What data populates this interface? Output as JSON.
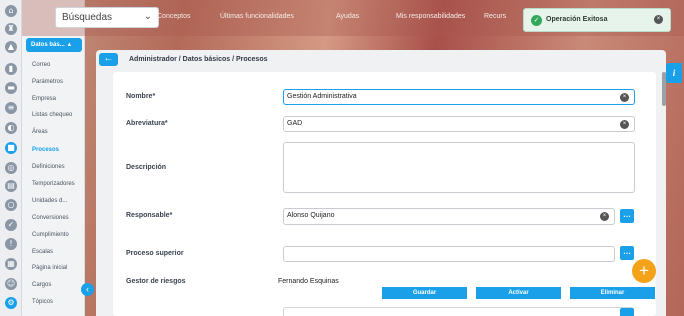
{
  "topbar": {
    "search_value": "Búsquedas",
    "nav": [
      "Conceptos",
      "Últimas funcionalidades",
      "Ayudas",
      "Mis responsabilidades",
      "Recurs"
    ]
  },
  "toast": {
    "message": "Operación Exitosa"
  },
  "sidebar": {
    "header": "Datos bás... ▲",
    "items": [
      {
        "label": "Correo"
      },
      {
        "label": "Parámetros"
      },
      {
        "label": "Empresa"
      },
      {
        "label": "Listas chequeo"
      },
      {
        "label": "Áreas"
      },
      {
        "label": "Procesos",
        "active": true
      },
      {
        "label": "Definiciones"
      },
      {
        "label": "Temporizadores"
      },
      {
        "label": "Unidades d..."
      },
      {
        "label": "Conversiones"
      },
      {
        "label": "Cumplimiento"
      },
      {
        "label": "Escalas"
      },
      {
        "label": "Página inicial"
      },
      {
        "label": "Cargos"
      },
      {
        "label": "Tópicos"
      }
    ]
  },
  "rail_icons": [
    "home-icon",
    "tower-icon",
    "user-icon",
    "chart-icon",
    "monitor-icon",
    "list-icon",
    "gauge-icon",
    "briefcase-icon",
    "target-icon",
    "document-icon",
    "circle-icon",
    "check-icon",
    "warning-icon",
    "calendar-icon",
    "person-icon",
    "triangle-icon",
    "gear-icon"
  ],
  "info_tab": "i",
  "breadcrumb": "Administrador / Datos básicos / Procesos",
  "form": {
    "nombre_label": "Nombre*",
    "nombre_value": "Gestión Administrativa",
    "abreviatura_label": "Abreviatura*",
    "abreviatura_value": "GAD",
    "descripcion_label": "Descripción",
    "descripcion_value": "",
    "responsable_label": "Responsable*",
    "responsable_value": "Alonso Quijano",
    "proceso_superior_label": "Proceso superior",
    "proceso_superior_value": "",
    "gestor_label": "Gestor de riesgos",
    "gestor_value": "Fernando Esquinas"
  },
  "actions": {
    "save": "Guardar",
    "activate": "Activar",
    "delete": "Eliminar"
  },
  "colors": {
    "accent": "#1aa0e8",
    "fab": "#f5a21b",
    "success": "#33a85a"
  }
}
